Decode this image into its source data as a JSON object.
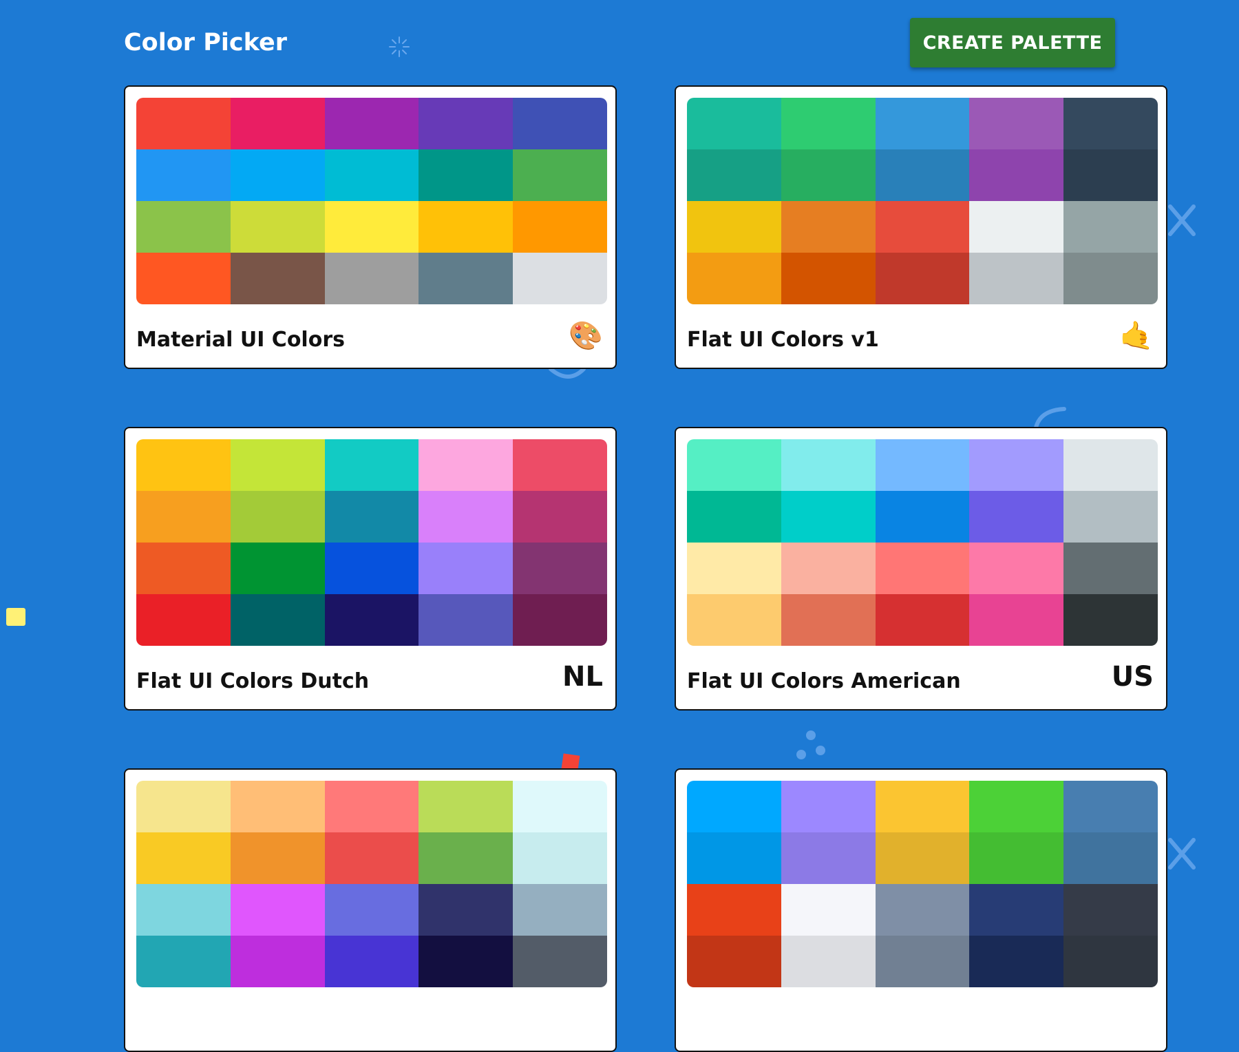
{
  "header": {
    "title": "Color Picker",
    "create_button_label": "CREATE PALETTE"
  },
  "colors": {
    "background": "#1d7ad4",
    "create_button": "#2e7d32"
  },
  "palettes": [
    {
      "name": "Material UI Colors",
      "emoji": "🎨",
      "colors": [
        "#f44336",
        "#e91e63",
        "#9c27b0",
        "#673ab7",
        "#3f51b5",
        "#2196f3",
        "#03a9f4",
        "#00bcd4",
        "#009688",
        "#4caf50",
        "#8bc34a",
        "#cddc39",
        "#ffeb3b",
        "#ffc107",
        "#ff9800",
        "#ff5722",
        "#795548",
        "#9e9e9e",
        "#607d8b",
        "#dcdfe3"
      ]
    },
    {
      "name": "Flat UI Colors v1",
      "emoji": "🤙",
      "colors": [
        "#1abc9c",
        "#2ecc71",
        "#3498db",
        "#9b59b6",
        "#34495e",
        "#16a085",
        "#27ae60",
        "#2980b9",
        "#8e44ad",
        "#2c3e50",
        "#f1c40f",
        "#e67e22",
        "#e74c3c",
        "#ecf0f1",
        "#95a5a6",
        "#f39c12",
        "#d35400",
        "#c0392b",
        "#bdc3c7",
        "#7f8c8d"
      ]
    },
    {
      "name": "Flat UI Colors Dutch",
      "emoji": "NL",
      "colors": [
        "#ffc312",
        "#c4e538",
        "#12cbc4",
        "#fda7df",
        "#ed4c67",
        "#f79f1f",
        "#a3cb38",
        "#1289a7",
        "#d980fa",
        "#b53471",
        "#ee5a24",
        "#009432",
        "#0652dd",
        "#9980fa",
        "#833471",
        "#ea2027",
        "#006266",
        "#1b1464",
        "#5758bb",
        "#6f1e51"
      ]
    },
    {
      "name": "Flat UI Colors American",
      "emoji": "US",
      "colors": [
        "#55efc4",
        "#81ecec",
        "#74b9ff",
        "#a29bfe",
        "#dfe6e9",
        "#00b894",
        "#00cec9",
        "#0984e3",
        "#6c5ce7",
        "#b2bec3",
        "#ffeaa7",
        "#fab1a0",
        "#ff7675",
        "#fd79a8",
        "#636e72",
        "#fdcb6e",
        "#e17055",
        "#d63031",
        "#e84393",
        "#2d3436"
      ]
    },
    {
      "name": "",
      "emoji": "",
      "colors": [
        "#f6e58d",
        "#ffbe76",
        "#ff7979",
        "#badc58",
        "#dff9fb",
        "#f9ca24",
        "#f0932b",
        "#eb4d4b",
        "#6ab04c",
        "#c7ecee",
        "#7ed6df",
        "#e056fd",
        "#686de0",
        "#30336b",
        "#95afc0",
        "#22a6b3",
        "#be2edd",
        "#4834d4",
        "#130f40",
        "#535c68"
      ]
    },
    {
      "name": "",
      "emoji": "",
      "colors": [
        "#00a8ff",
        "#9c88ff",
        "#fbc531",
        "#4cd137",
        "#487eb0",
        "#0097e6",
        "#8c7ae6",
        "#e1b12c",
        "#44bd32",
        "#40739e",
        "#e84118",
        "#f5f6fa",
        "#7f8fa6",
        "#273c75",
        "#353b48",
        "#c23616",
        "#dcdde1",
        "#718093",
        "#192a56",
        "#2f3640"
      ]
    }
  ]
}
